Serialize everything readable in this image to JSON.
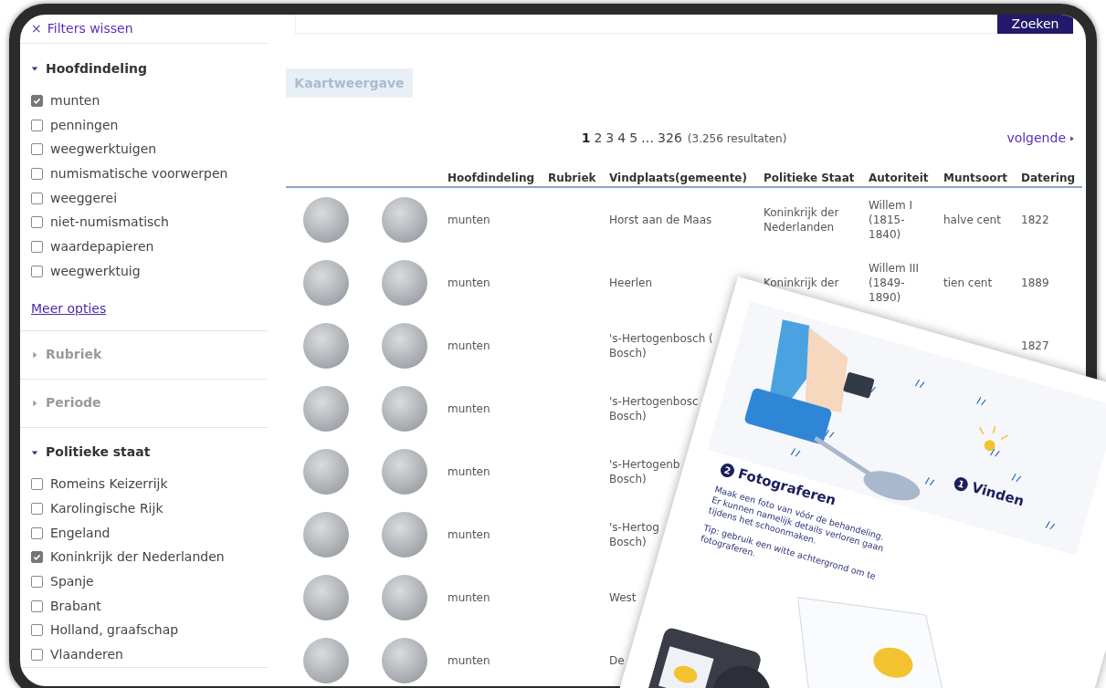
{
  "sidebar": {
    "clear_filters": {
      "icon": "×",
      "label": "Filters wissen"
    },
    "groups": [
      {
        "title": "Hoofdindeling",
        "expanded": true,
        "options": [
          {
            "label": "munten",
            "checked": true
          },
          {
            "label": "penningen",
            "checked": false
          },
          {
            "label": "weegwerktuigen",
            "checked": false
          },
          {
            "label": "numismatische voorwerpen",
            "checked": false
          },
          {
            "label": "weeggerei",
            "checked": false
          },
          {
            "label": "niet-numismatisch",
            "checked": false
          },
          {
            "label": "waardepapieren",
            "checked": false
          },
          {
            "label": "weegwerktuig",
            "checked": false
          }
        ],
        "more_link": "Meer opties"
      },
      {
        "title": "Rubriek",
        "expanded": false
      },
      {
        "title": "Periode",
        "expanded": false
      },
      {
        "title": "Politieke staat",
        "expanded": true,
        "options": [
          {
            "label": "Romeins Keizerrijk",
            "checked": false
          },
          {
            "label": "Karolingische Rijk",
            "checked": false
          },
          {
            "label": "Engeland",
            "checked": false
          },
          {
            "label": "Koninkrijk der Nederlanden",
            "checked": true
          },
          {
            "label": "Spanje",
            "checked": false
          },
          {
            "label": "Brabant",
            "checked": false
          },
          {
            "label": "Holland, graafschap",
            "checked": false
          },
          {
            "label": "Vlaanderen",
            "checked": false
          }
        ]
      }
    ]
  },
  "search": {
    "button": "Zoeken"
  },
  "map_button": {
    "label": "Kaartweergave",
    "disabled": true
  },
  "pagination": {
    "pages": [
      {
        "kind": "page",
        "label": "1",
        "selected": true
      },
      {
        "kind": "page",
        "label": "2",
        "selected": false
      },
      {
        "kind": "page",
        "label": "3",
        "selected": false
      },
      {
        "kind": "page",
        "label": "4",
        "selected": false
      },
      {
        "kind": "page",
        "label": "5",
        "selected": false
      },
      {
        "kind": "gap",
        "label": "…"
      },
      {
        "kind": "page",
        "label": "326",
        "selected": false
      }
    ],
    "count": "(3.256 resultaten)",
    "next": "volgende"
  },
  "table": {
    "columns": [
      "Hoofdindeling",
      "Rubriek",
      "Vindplaats(gemeente)",
      "Politieke Staat",
      "Autoriteit",
      "Muntsoort",
      "Datering"
    ],
    "rows": [
      {
        "hoofdindeling": "munten",
        "vindplaats": [
          "Horst aan de Maas"
        ],
        "politieke_staat": "Koninkrijk der Nederlanden",
        "autoriteit": "Willem I (1815-1840)",
        "muntsoort": "halve cent",
        "datering": "1822"
      },
      {
        "hoofdindeling": "munten",
        "vindplaats": [
          "Heerlen"
        ],
        "politieke_staat": "Koninkrijk der",
        "autoriteit": "Willem III (1849-1890)",
        "muntsoort": "tien cent",
        "datering": "1889"
      },
      {
        "hoofdindeling": "munten",
        "vindplaats": [
          "'s-Hertogenbosch (",
          "Bosch)"
        ],
        "datering": "1827"
      },
      {
        "hoofdindeling": "munten",
        "vindplaats": [
          "'s-Hertogenbosc",
          "Bosch)"
        ]
      },
      {
        "hoofdindeling": "munten",
        "vindplaats": [
          "'s-Hertogenb",
          "Bosch)"
        ]
      },
      {
        "hoofdindeling": "munten",
        "vindplaats": [
          "'s-Hertog",
          "Bosch)"
        ]
      },
      {
        "hoofdindeling": "munten",
        "vindplaats": [
          "West"
        ]
      },
      {
        "hoofdindeling": "munten",
        "vindplaats": [
          "De"
        ]
      }
    ]
  },
  "leaflet": {
    "steps": [
      {
        "number": "2",
        "title": "Fotograferen"
      },
      {
        "number": "1",
        "title": "Vinden"
      }
    ],
    "paragraphs": [
      "Maak een foto van vóór de behandeling. Er kunnen namelijk details verloren gaan tijdens het schoonmaken.",
      "Tip: gebruik een witte achtergrond om te fotograferen."
    ]
  }
}
